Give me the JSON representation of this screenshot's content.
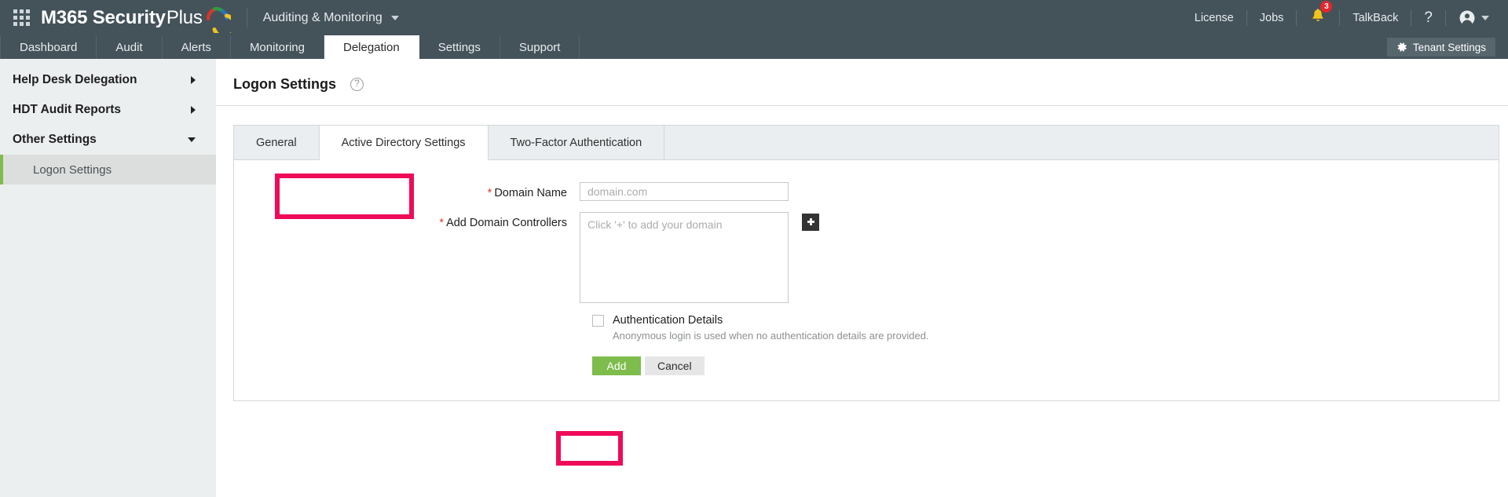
{
  "header": {
    "app_grid_icon": "app-grid-icon",
    "brand_bold": "M365 Security",
    "brand_light": "Plus",
    "module": "Auditing & Monitoring",
    "module_caret_icon": "chevron-down-icon",
    "license": "License",
    "jobs": "Jobs",
    "notification_icon": "bell-icon",
    "notification_count": "3",
    "talkback": "TalkBack",
    "help": "?",
    "account_icon": "user-avatar-icon",
    "account_caret_icon": "chevron-down-icon"
  },
  "nav": {
    "tabs": [
      {
        "label": "Dashboard",
        "active": false
      },
      {
        "label": "Audit",
        "active": false
      },
      {
        "label": "Alerts",
        "active": false
      },
      {
        "label": "Monitoring",
        "active": false
      },
      {
        "label": "Delegation",
        "active": true
      },
      {
        "label": "Settings",
        "active": false
      },
      {
        "label": "Support",
        "active": false
      }
    ],
    "tenant_settings": "Tenant Settings",
    "tenant_settings_icon": "gear-icon"
  },
  "sidebar": {
    "items": [
      {
        "label": "Help Desk Delegation",
        "expanded": false
      },
      {
        "label": "HDT Audit Reports",
        "expanded": false
      },
      {
        "label": "Other Settings",
        "expanded": true
      }
    ],
    "sub_items": [
      {
        "label": "Logon Settings",
        "selected": true
      }
    ]
  },
  "page": {
    "title": "Logon Settings",
    "help_icon": "help-circle-icon"
  },
  "card": {
    "tabs": [
      {
        "label": "General",
        "active": false
      },
      {
        "label": "Active Directory Settings",
        "active": true
      },
      {
        "label": "Two-Factor Authentication",
        "active": false
      }
    ]
  },
  "form": {
    "domain_name_label": "Domain Name",
    "domain_name_value": "",
    "domain_name_placeholder": "domain.com",
    "domain_controllers_label": "Add Domain Controllers",
    "domain_controllers_value": "",
    "domain_controllers_placeholder": "Click '+' to add your domain",
    "add_controller_icon": "plus-icon",
    "required_marker": "*",
    "auth_details_label": "Authentication Details",
    "auth_details_checked": false,
    "auth_details_hint": "Anonymous login is used when no authentication details are provided.",
    "add_button": "Add",
    "cancel_button": "Cancel"
  },
  "annotations": {
    "highlight_color": "#ef0a5a",
    "boxes": [
      {
        "name": "active-directory-settings-tab-highlight"
      },
      {
        "name": "add-button-highlight"
      }
    ]
  },
  "colors": {
    "header_bg": "#44525a",
    "accent_green": "#7ebc4c",
    "sidebar_bg": "#eceff0",
    "tabstrip_bg": "#eaeef0",
    "required_red": "#e23b2e",
    "badge_red": "#e8252b"
  }
}
